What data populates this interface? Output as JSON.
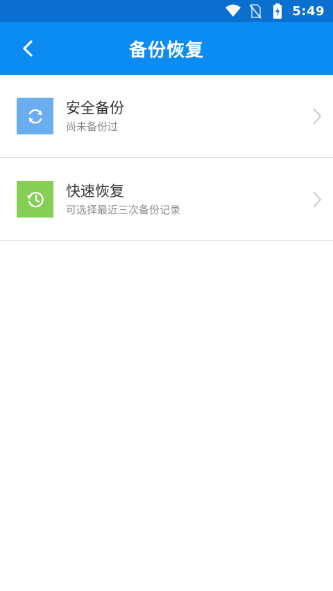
{
  "status_bar": {
    "time": "5:49",
    "icons": [
      "wifi-icon",
      "no-sim-icon",
      "battery-charging-icon"
    ]
  },
  "app_bar": {
    "title": "备份恢复",
    "back_icon": "back-arrow-icon"
  },
  "items": [
    {
      "label": "安全备份",
      "sublabel": "尚未备份过",
      "icon": "sync-icon",
      "tile_color": "#6aaef0"
    },
    {
      "label": "快速恢复",
      "sublabel": "可选择最近三次备份记录",
      "icon": "restore-clock-icon",
      "tile_color": "#86cf55"
    }
  ],
  "colors": {
    "status_bar": "#0a6fcf",
    "app_bar": "#0a8cf2",
    "divider": "#d9d9d9"
  }
}
